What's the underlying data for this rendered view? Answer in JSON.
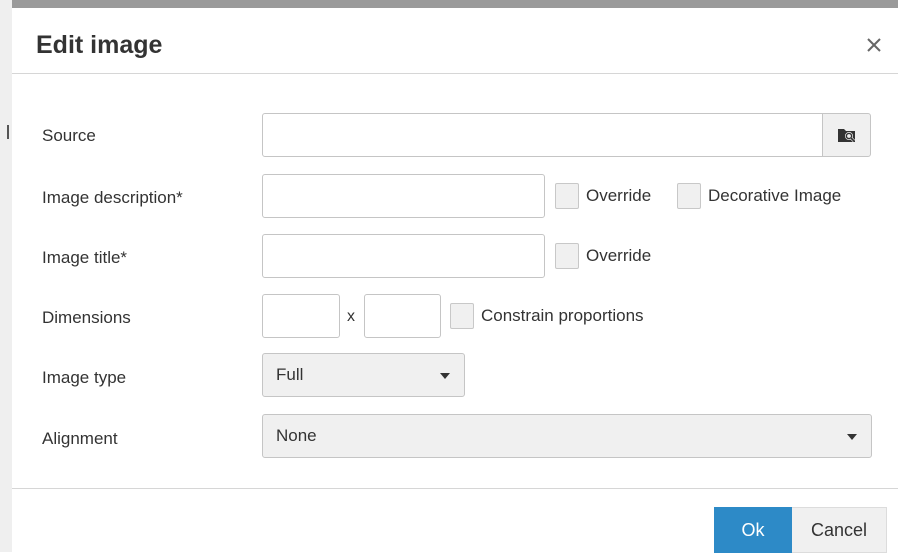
{
  "dialog": {
    "title": "Edit image",
    "close_icon": "close-icon"
  },
  "form": {
    "source": {
      "label": "Source",
      "value": "",
      "browse_icon": "folder-search-icon"
    },
    "image_description": {
      "label": "Image description*",
      "value": "",
      "override_label": "Override",
      "decorative_label": "Decorative Image"
    },
    "image_title": {
      "label": "Image title*",
      "value": "",
      "override_label": "Override"
    },
    "dimensions": {
      "label": "Dimensions",
      "width_value": "",
      "separator": "x",
      "height_value": "",
      "constrain_label": "Constrain proportions"
    },
    "image_type": {
      "label": "Image type",
      "selected": "Full"
    },
    "alignment": {
      "label": "Alignment",
      "selected": "None"
    }
  },
  "footer": {
    "ok_label": "Ok",
    "cancel_label": "Cancel"
  },
  "colors": {
    "primary": "#2d8ac7",
    "control_bg": "#f0f0f0",
    "border": "#c5c5c5"
  }
}
